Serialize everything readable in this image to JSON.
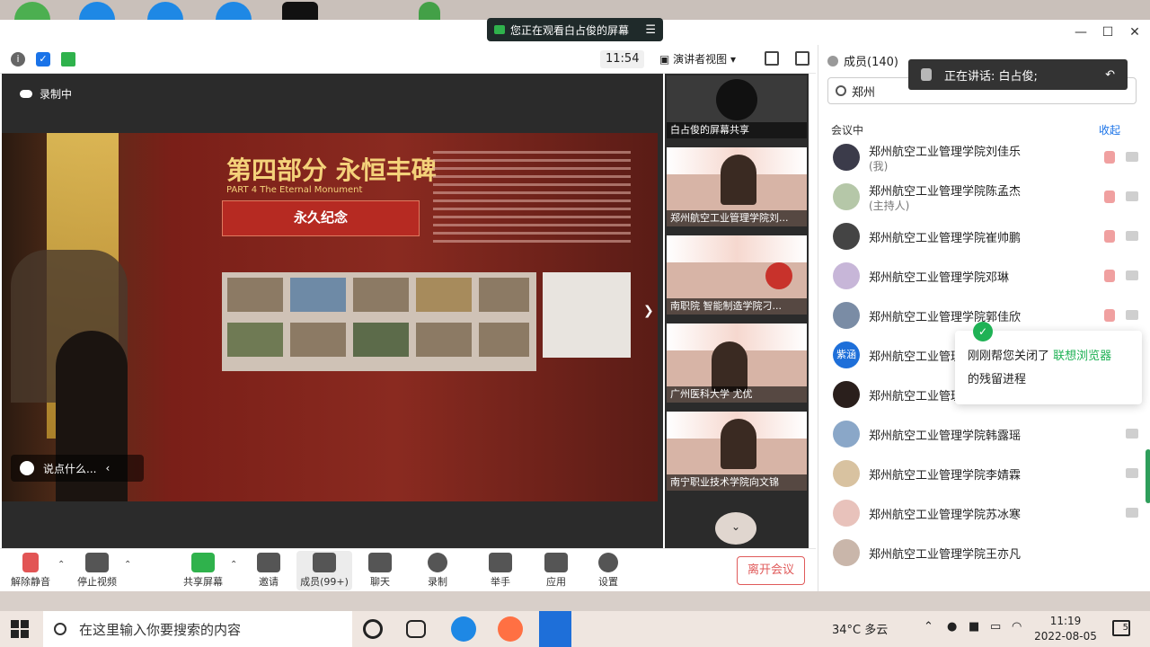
{
  "share_banner": {
    "text": "您正在观看白占俊的屏幕"
  },
  "toolbar": {
    "time": "11:54",
    "view_label": "演讲者视图"
  },
  "stage": {
    "recording_label": "录制中",
    "chat_placeholder": "说点什么...",
    "wall_title": "第四部分 永恒丰碑",
    "wall_subtitle": "PART 4 The Eternal Monument",
    "plaque": "永久纪念"
  },
  "gallery": {
    "screen_share_label": "白占俊的屏幕共享",
    "tiles": [
      {
        "name": "郑州航空工业管理学院刘..."
      },
      {
        "name": "南职院 智能制造学院刁..."
      },
      {
        "name": "广州医科大学 尤优"
      },
      {
        "name": "南宁职业技术学院向文锦"
      }
    ]
  },
  "bottom_bar": {
    "unmute": "解除静音",
    "stop_video": "停止视频",
    "share_screen": "共享屏幕",
    "invite": "邀请",
    "members": "成员(99+)",
    "chat": "聊天",
    "record": "录制",
    "raise_hand": "举手",
    "apps": "应用",
    "settings": "设置",
    "leave": "离开会议"
  },
  "panel": {
    "title": "成员(140)",
    "speaking": "正在讲话: 白占俊;",
    "search_value": "郑州",
    "section": "会议中",
    "collapse": "收起",
    "members": [
      {
        "name": "郑州航空工业管理学院刘佳乐",
        "role": "(我)"
      },
      {
        "name": "郑州航空工业管理学院陈孟杰",
        "role": "(主持人)"
      },
      {
        "name": "郑州航空工业管理学院崔帅鹏",
        "role": ""
      },
      {
        "name": "郑州航空工业管理学院邓琳",
        "role": ""
      },
      {
        "name": "郑州航空工业管理学院郭佳欣",
        "role": ""
      },
      {
        "name": "郑州航空工业管理",
        "role": "",
        "avatar": "紫涵"
      },
      {
        "name": "郑州航空工业管理",
        "role": ""
      },
      {
        "name": "郑州航空工业管理学院韩露瑶",
        "role": ""
      },
      {
        "name": "郑州航空工业管理学院李婧霖",
        "role": ""
      },
      {
        "name": "郑州航空工业管理学院苏冰寒",
        "role": ""
      },
      {
        "name": "郑州航空工业管理学院王亦凡",
        "role": ""
      }
    ],
    "toast_text": "刚刚帮您关闭了",
    "toast_link": "联想浏览器",
    "toast_text2": "的残留进程"
  },
  "taskbar": {
    "search_placeholder": "在这里输入你要搜索的内容",
    "weather": "34°C 多云",
    "time": "11:19",
    "date": "2022-08-05",
    "notifications": "5"
  }
}
